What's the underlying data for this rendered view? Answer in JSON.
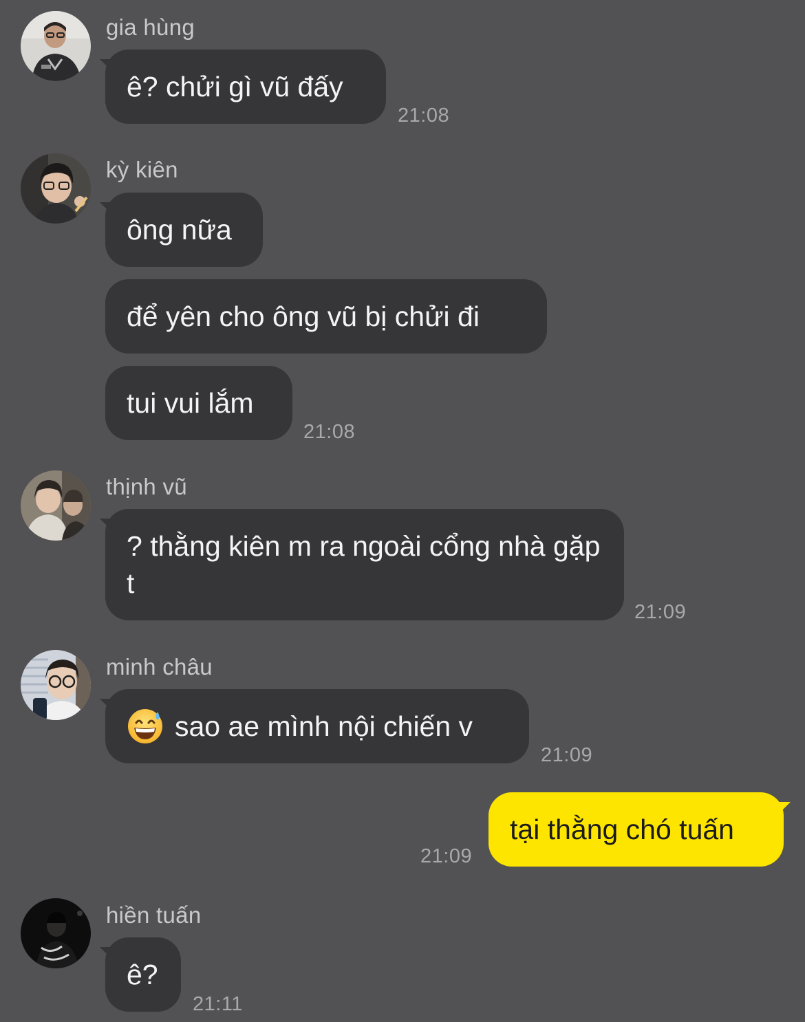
{
  "colors": {
    "background": "#525153",
    "bubble_other": "#363538",
    "bubble_me": "#fee500",
    "text_other": "#f4f4f5",
    "text_me": "#1b1b1b",
    "meta_text": "#a9a8aa"
  },
  "messages": [
    {
      "sender": "gia hùng",
      "avatar": "avatar-gia-hung",
      "bubbles": [
        "ê? chửi gì vũ đấy"
      ],
      "time": "21:08"
    },
    {
      "sender": "kỳ kiên",
      "avatar": "avatar-ky-kien",
      "bubbles": [
        "ông nữa",
        "để yên cho ông vũ bị chửi đi",
        "tui vui lắm"
      ],
      "time": "21:08"
    },
    {
      "sender": "thịnh vũ",
      "avatar": "avatar-thinh-vu",
      "bubbles": [
        "? thằng kiên m ra ngoài cổng nhà gặp t"
      ],
      "time": "21:09"
    },
    {
      "sender": "minh châu",
      "avatar": "avatar-minh-chau",
      "bubbles": [
        "sao ae mình nội chiến v"
      ],
      "emoji": "grinning-face-with-sweat-icon",
      "time": "21:09"
    },
    {
      "sender": "me",
      "outgoing": true,
      "bubbles": [
        "tại thằng chó tuấn"
      ],
      "time": "21:09"
    },
    {
      "sender": "hiền tuấn",
      "avatar": "avatar-hien-tuan",
      "bubbles": [
        "ê?"
      ],
      "time": "21:11"
    }
  ]
}
